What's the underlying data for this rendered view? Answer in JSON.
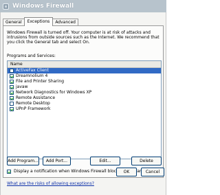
{
  "window": {
    "title": "Windows Firewall"
  },
  "tabs": [
    {
      "label": "General",
      "active": false
    },
    {
      "label": "Exceptions",
      "active": true
    },
    {
      "label": "Advanced",
      "active": false
    }
  ],
  "intro_text": "Windows Firewall is turned off. Your computer is at risk of attacks and intrusions from outside sources such as the Internet. We recommend that you click the General tab and select On.",
  "programs_label": "Programs and Services:",
  "list": {
    "header": "Name",
    "items": [
      {
        "label": "ActiveFax Client",
        "checked": false,
        "selected": true
      },
      {
        "label": "Dreamnolium 4",
        "checked": true,
        "selected": false
      },
      {
        "label": "File and Printer Sharing",
        "checked": true,
        "selected": false
      },
      {
        "label": "javaw",
        "checked": true,
        "selected": false
      },
      {
        "label": "Network Diagnostics for Windows XP",
        "checked": true,
        "selected": false
      },
      {
        "label": "Remote Assistance",
        "checked": true,
        "selected": false
      },
      {
        "label": "Remote Desktop",
        "checked": false,
        "selected": false
      },
      {
        "label": "UPnP Framework",
        "checked": true,
        "selected": false
      }
    ]
  },
  "buttons": {
    "add_program": "Add Program...",
    "add_port": "Add Port...",
    "edit": "Edit...",
    "delete": "Delete",
    "ok": "OK",
    "cancel": "Cancel"
  },
  "notify": {
    "label": "Display a notification when Windows Firewall blocks a program",
    "checked": true
  },
  "risk_link": "What are the risks of allowing exceptions?",
  "colors": {
    "selection": "#316ac5",
    "link": "#0b2fa8",
    "titlebar": "#b7c3cc"
  }
}
